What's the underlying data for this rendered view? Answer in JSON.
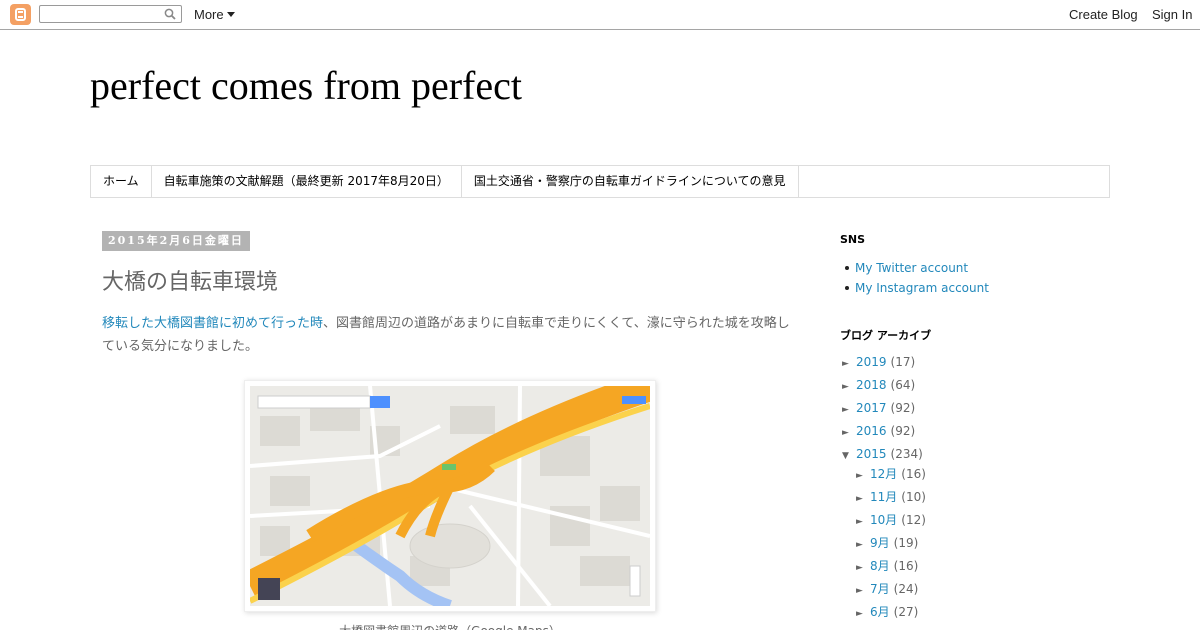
{
  "navbar": {
    "more_label": "More",
    "create_blog_label": "Create Blog",
    "sign_in_label": "Sign In"
  },
  "header": {
    "blog_title": "perfect comes from perfect"
  },
  "tabs": [
    {
      "label": "ホーム"
    },
    {
      "label": "自転車施策の文献解題（最終更新 2017年8月20日）"
    },
    {
      "label": "国土交通省・警察庁の自転車ガイドラインについての意見"
    }
  ],
  "post": {
    "date": "2015年2月6日金曜日",
    "title": "大橋の自転車環境",
    "body_link": "移転した大橋図書館に初めて行った時",
    "body_text": "、図書館周辺の道路があまりに自転車で走りにくくて、濠に守られた城を攻略している気分になりました。",
    "image_caption": "大橋図書館周辺の道路（Google Maps）"
  },
  "sidebar": {
    "sns_heading": "SNS",
    "sns_links": [
      {
        "label": "My Twitter account"
      },
      {
        "label": "My Instagram account"
      }
    ],
    "archive_heading": "ブログ アーカイブ",
    "years": [
      {
        "label": "2019",
        "count": "(17)",
        "expanded": false
      },
      {
        "label": "2018",
        "count": "(64)",
        "expanded": false
      },
      {
        "label": "2017",
        "count": "(92)",
        "expanded": false
      },
      {
        "label": "2016",
        "count": "(92)",
        "expanded": false
      },
      {
        "label": "2015",
        "count": "(234)",
        "expanded": true
      }
    ],
    "months": [
      {
        "label": "12月",
        "count": "(16)"
      },
      {
        "label": "11月",
        "count": "(10)"
      },
      {
        "label": "10月",
        "count": "(12)"
      },
      {
        "label": "9月",
        "count": "(19)"
      },
      {
        "label": "8月",
        "count": "(16)"
      },
      {
        "label": "7月",
        "count": "(24)"
      },
      {
        "label": "6月",
        "count": "(27)"
      }
    ],
    "collapsed_glyph": "►",
    "expanded_glyph": "▼"
  },
  "colors": {
    "link": "#2288bb",
    "highway": "#f5a623",
    "river": "#a4c3f4"
  }
}
